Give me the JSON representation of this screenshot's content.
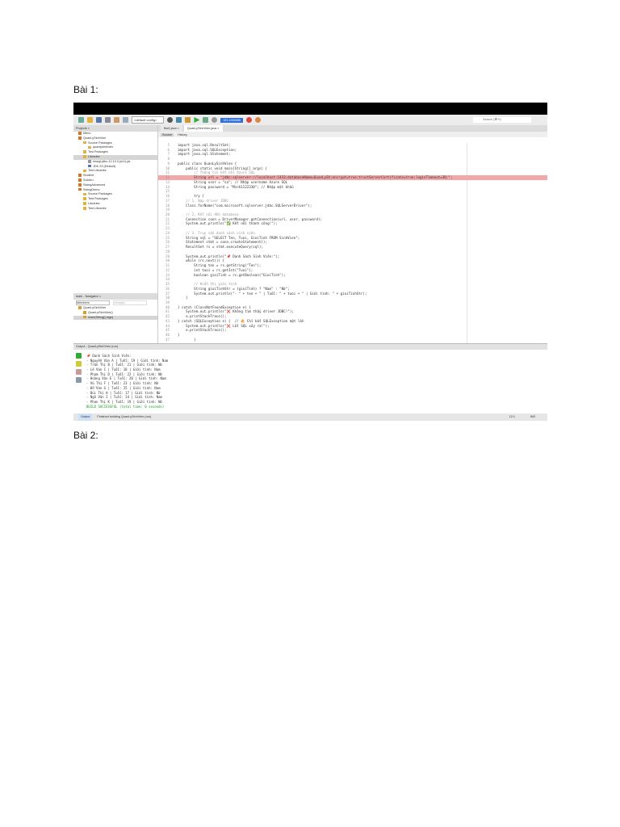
{
  "headings": {
    "bai1": "Bài 1:",
    "bai2": "Bài 2:"
  },
  "ide": {
    "toolbar": {
      "config": "<default config>",
      "memory": "321.2/450MB",
      "search_placeholder": "Search (⌘+I)"
    },
    "projects": {
      "tab": "Projects ×",
      "items": [
        {
          "label": "Menu",
          "color": "#d9731f",
          "indent": 1
        },
        {
          "label": "QuanLySinhVien",
          "color": "#d9731f",
          "indent": 1
        },
        {
          "label": "Source Packages",
          "color": "#e3b23c",
          "indent": 2
        },
        {
          "label": "quanlysinhvien",
          "color": "#e3b23c",
          "indent": 3
        },
        {
          "label": "Test Packages",
          "color": "#e3b23c",
          "indent": 2
        },
        {
          "label": "Libraries",
          "color": "#e3b23c",
          "indent": 2,
          "selected": true
        },
        {
          "label": "mssql-jdbc-12.10.0.jre11.jar",
          "color": "#999999",
          "indent": 3
        },
        {
          "label": "JDK 23 (Default)",
          "color": "#5577aa",
          "indent": 3
        },
        {
          "label": "Test Libraries",
          "color": "#e3b23c",
          "indent": 2
        },
        {
          "label": "Student",
          "color": "#d9731f",
          "indent": 1
        },
        {
          "label": "SubAru",
          "color": "#d9731f",
          "indent": 1
        },
        {
          "label": "SwingAdvanced",
          "color": "#d9731f",
          "indent": 1
        },
        {
          "label": "SwingDemo",
          "color": "#d9731f",
          "indent": 1
        },
        {
          "label": "Source Packages",
          "color": "#e3b23c",
          "indent": 2
        },
        {
          "label": "Test Packages",
          "color": "#e3b23c",
          "indent": 2
        },
        {
          "label": "Libraries",
          "color": "#e3b23c",
          "indent": 2
        },
        {
          "label": "Test Libraries",
          "color": "#e3b23c",
          "indent": 2
        }
      ]
    },
    "navigator": {
      "tab": "main - Navigator ×",
      "members": "Members",
      "empty": "<empty>",
      "items": [
        {
          "label": "QuanLySinhVien",
          "indent": 1
        },
        {
          "label": "QuanLySinhVien()",
          "indent": 2
        },
        {
          "label": "main(String[] args)",
          "indent": 2,
          "selected": true
        }
      ]
    },
    "editor": {
      "tabs": [
        {
          "label": "Bai1.java ×",
          "active": false
        },
        {
          "label": "QuanLySinhVien.java ×",
          "active": true
        }
      ],
      "source_tab": "Source",
      "history_tab": "History",
      "error_line": 12,
      "lines": [
        {
          "n": "5",
          "t": "import java.sql.ResultSet;"
        },
        {
          "n": "6",
          "t": "import java.sql.SQLException;"
        },
        {
          "n": "7",
          "t": "import java.sql.Statement;"
        },
        {
          "n": "8",
          "t": ""
        },
        {
          "n": "9",
          "t": "public class QuanLySinhVien {"
        },
        {
          "n": "10",
          "t": "    public static void main(String[] args) {"
        },
        {
          "n": "11",
          "t": "        // Thông tin kết nối Azure SQL"
        },
        {
          "n": "12",
          "t": "        String url = \"jdbc:sqlserver://localhost:1433;databaseName=QuanLySV;encrypt=true;trustServerCertificate=true;loginTimeout=30;\";"
        },
        {
          "n": "13",
          "t": "        String user = \"sa\"; // Nhập username Azure SQL"
        },
        {
          "n": "14",
          "t": "        String password = \"Minh1122330\"; // Nhập mật khẩu"
        },
        {
          "n": "15",
          "t": ""
        },
        {
          "n": "16",
          "t": "        try {"
        },
        {
          "n": "17",
          "t": "    // 1. Nạp driver JDBC"
        },
        {
          "n": "18",
          "t": "    Class.forName(\"com.microsoft.sqlserver.jdbc.SQLServerDriver\");"
        },
        {
          "n": "19",
          "t": ""
        },
        {
          "n": "20",
          "t": "    // 2. Kết nối đến database"
        },
        {
          "n": "21",
          "t": "    Connection conn = DriverManager.getConnection(url, user, password);"
        },
        {
          "n": "22",
          "t": "    System.out.println(\"✅ Kết nối thành công!\");"
        },
        {
          "n": "23",
          "t": ""
        },
        {
          "n": "24",
          "t": "    // 3. Truy vấn danh sách sinh viên"
        },
        {
          "n": "25",
          "t": "    String sql = \"SELECT Ten, Tuoi, GioiTinh FROM SinhVien\";"
        },
        {
          "n": "26",
          "t": "    Statement stmt = conn.createStatement();"
        },
        {
          "n": "27",
          "t": "    ResultSet rs = stmt.executeQuery(sql);"
        },
        {
          "n": "28",
          "t": ""
        },
        {
          "n": "29",
          "t": "    System.out.println(\"📌 Danh Sách Sinh Viên:\");"
        },
        {
          "n": "30",
          "t": "    while (rs.next()) {"
        },
        {
          "n": "31",
          "t": "        String ten = rs.getString(\"Ten\");"
        },
        {
          "n": "32",
          "t": "        int tuoi = rs.getInt(\"Tuoi\");"
        },
        {
          "n": "33",
          "t": "        boolean gioiTinh = rs.getBoolean(\"GioiTinh\");"
        },
        {
          "n": "34",
          "t": ""
        },
        {
          "n": "35",
          "t": "        // Hiển thị giới tính"
        },
        {
          "n": "36",
          "t": "        String gioiTinhStr = (gioiTinh) ? \"Nam\" : \"Nữ\";"
        },
        {
          "n": "37",
          "t": "        System.out.println(\"- \" + ten + \" | Tuổi: \" + tuoi + \" | Giới tính: \" + gioiTinhStr);"
        },
        {
          "n": "38",
          "t": "    }"
        },
        {
          "n": "39",
          "t": ""
        },
        {
          "n": "40",
          "t": "} catch (ClassNotFoundException e) {"
        },
        {
          "n": "41",
          "t": "    System.out.println(\"❌ Không tìm thấy driver JDBC!\");"
        },
        {
          "n": "42",
          "t": "    e.printStackTrace();"
        },
        {
          "n": "43",
          "t": "} catch (SQLException e) {  // 🔥 Chỉ bắt SQLException một lần"
        },
        {
          "n": "44",
          "t": "    System.out.println(\"❌ Lỗi SQL xảy ra!\");"
        },
        {
          "n": "45",
          "t": "    e.printStackTrace();"
        },
        {
          "n": "46",
          "t": "}"
        },
        {
          "n": "47",
          "t": "        }"
        }
      ]
    },
    "output": {
      "title": "Output - QuanLySinhVien (run)",
      "lines": [
        "📌 Danh Sách Sinh Viên:",
        "- Nguyễn Văn A | Tuổi: 19 | Giới tính: Nam",
        "- Trần Thị B | Tuổi: 21 | Giới tính: Nữ",
        "- Lê Văn C | Tuổi: 18 | Giới tính: Nam",
        "- Phạm Thị D | Tuổi: 22 | Giới tính: Nữ",
        "- Hoàng Văn E | Tuổi: 20 | Giới tính: Nam",
        "- Vũ Thị F | Tuổi: 23 | Giới tính: Nữ",
        "- Đỗ Văn G | Tuổi: 25 | Giới tính: Nam",
        "- Bùi Thị H | Tuổi: 17 | Giới tính: Nữ",
        "- Ngô Văn I | Tuổi: 24 | Giới tính: Nam",
        "- Phan Thị K | Tuổi: 19 | Giới tính: Nữ"
      ],
      "build": "BUILD SUCCESSFUL (total time: 0 seconds)"
    },
    "status": {
      "output_tab": "Output",
      "message": "Finished building QuanLySinhVien (run).",
      "position": "12:1",
      "mode": "INS"
    }
  }
}
